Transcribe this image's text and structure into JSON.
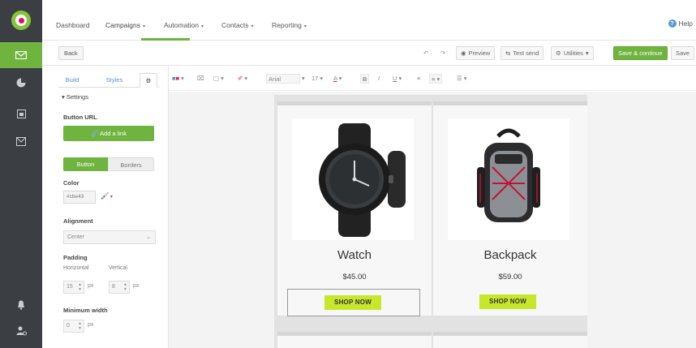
{
  "nav": {
    "items": [
      {
        "label": "Dashboard",
        "caret": ""
      },
      {
        "label": "Campaigns",
        "caret": "▾"
      },
      {
        "label": "Automation",
        "caret": "▾"
      },
      {
        "label": "Contacts",
        "caret": "▾"
      },
      {
        "label": "Reporting",
        "caret": "▾"
      }
    ],
    "help": "Help"
  },
  "actions": {
    "back": "Back",
    "undo": "↶",
    "redo": "↷",
    "preview": "Preview",
    "test_send": "Test send",
    "utilities": "Utilities",
    "save_continue": "Save & continue",
    "save": "Save"
  },
  "panel": {
    "tabs": [
      "Build",
      "Styles",
      "⚙"
    ],
    "section": "▾ Settings",
    "button_url_label": "Button URL",
    "add_link": "🔗 Add a link",
    "toggle": [
      "Button",
      "Borders"
    ],
    "color_label": "Color",
    "color_value": "#cbe43",
    "alignment_label": "Alignment",
    "alignment_value": "Center",
    "padding_label": "Padding",
    "horizontal_label": "Horizontal",
    "vertical_label": "Vertical",
    "horizontal_value": "15",
    "vertical_value": "8",
    "unit_px": "px",
    "min_width_label": "Minimum width",
    "min_width_value": "0"
  },
  "format_toolbar": {
    "font_family": "Arial",
    "font_size": "17",
    "bold": "B",
    "italic": "I",
    "underline": "U"
  },
  "products": [
    {
      "name": "Watch",
      "price": "$45.00",
      "cta": "SHOP NOW"
    },
    {
      "name": "Backpack",
      "price": "$59.00",
      "cta": "SHOP NOW"
    }
  ],
  "colors": {
    "rail": "#3b3f44",
    "brand_green": "#6fb43f",
    "cta_lime": "#c7e72b",
    "logo_pink": "#d8125b"
  }
}
